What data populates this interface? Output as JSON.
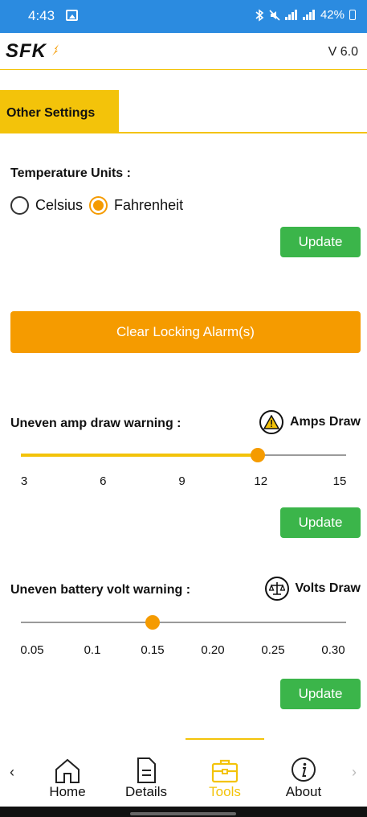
{
  "status_bar": {
    "time": "4:43",
    "icons_text": "LTE1 LTE2",
    "battery": "42%"
  },
  "header": {
    "logo_text": "SFK",
    "version": "V 6.0"
  },
  "section": {
    "title": "Other Settings"
  },
  "temperature": {
    "label": "Temperature Units :",
    "options": [
      "Celsius",
      "Fahrenheit"
    ],
    "selected": "Fahrenheit",
    "update_label": "Update"
  },
  "clear_alarm": {
    "label": "Clear Locking Alarm(s)"
  },
  "amp_warning": {
    "label": "Uneven amp draw warning :",
    "right_label": "Amps Draw",
    "icon": "warning-icon",
    "ticks": [
      "3",
      "6",
      "9",
      "12",
      "15"
    ],
    "min": 3,
    "max": 15,
    "value": 12,
    "update_label": "Update"
  },
  "volt_warning": {
    "label": "Uneven battery volt warning :",
    "right_label": "Volts Draw",
    "icon": "balance-scale-icon",
    "ticks": [
      "0.05",
      "0.1",
      "0.15",
      "0.20",
      "0.25",
      "0.30"
    ],
    "min": 0.05,
    "max": 0.3,
    "value": 0.15,
    "update_label": "Update"
  },
  "nav": {
    "items": [
      {
        "label": "Home",
        "icon": "home-icon"
      },
      {
        "label": "Details",
        "icon": "document-icon"
      },
      {
        "label": "Tools",
        "icon": "toolbox-icon",
        "active": true
      },
      {
        "label": "About",
        "icon": "info-icon"
      }
    ]
  },
  "colors": {
    "status_bar": "#2b8be0",
    "accent_yellow": "#f3c30a",
    "accent_orange": "#f59b00",
    "update_green": "#3bb54a"
  }
}
